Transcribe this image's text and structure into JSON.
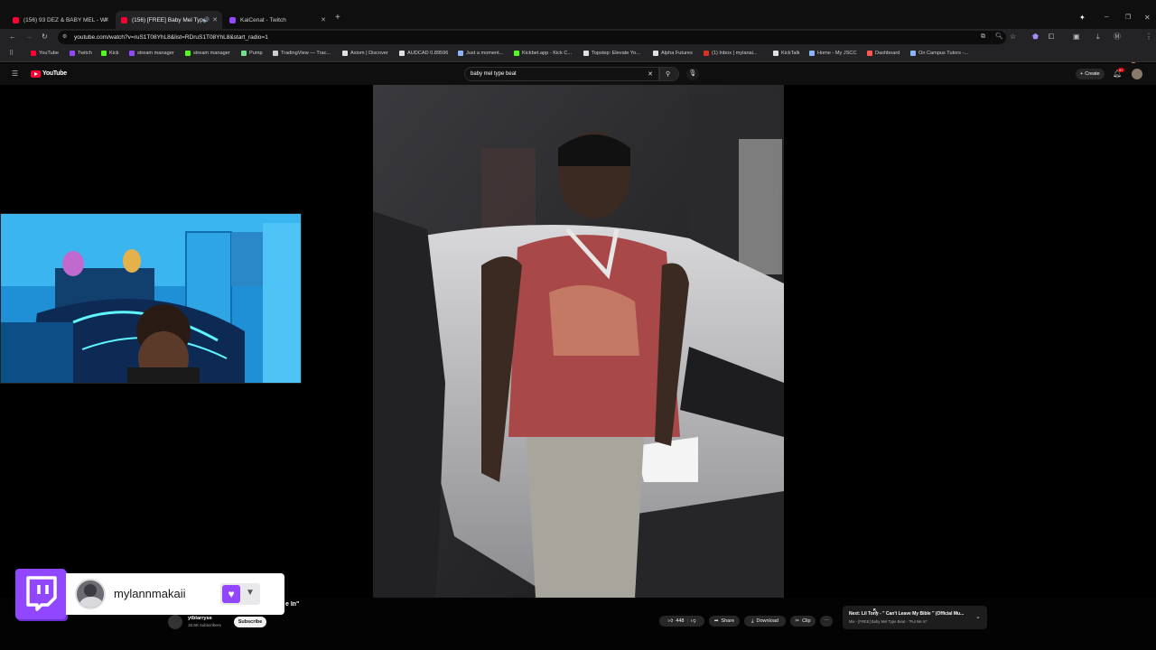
{
  "browser": {
    "tabs": [
      {
        "title": "(156) 93 DEZ & BABY MEL - Wi",
        "color": "#ff0033",
        "active": false
      },
      {
        "title": "(156) [FREE] Baby Mel Type",
        "color": "#ff0033",
        "active": true
      },
      {
        "title": "KaiCenat - Twitch",
        "color": "#9146ff",
        "active": false
      }
    ],
    "new_tab": "+",
    "url": "youtube.com/watch?v=ruS1T08YhL8&list=RDruS1T08YhL8&start_radio=1",
    "bookmarks": [
      {
        "label": "YouTube",
        "color": "#ff0033"
      },
      {
        "label": "Twitch",
        "color": "#9146ff"
      },
      {
        "label": "Kick",
        "color": "#53fc18"
      },
      {
        "label": "stream manager",
        "color": "#9146ff"
      },
      {
        "label": "stream manager",
        "color": "#53fc18"
      },
      {
        "label": "Pump",
        "color": "#6fe38a"
      },
      {
        "label": "TradingView — Trac...",
        "color": "#cccccc"
      },
      {
        "label": "Axiom | Discover",
        "color": "#e0e0e0"
      },
      {
        "label": "AUDCAD 0.89596",
        "color": "#e0e0e0"
      },
      {
        "label": "Just a moment...",
        "color": "#8ab4f8"
      },
      {
        "label": "Kickbet.app - Kick C...",
        "color": "#53fc18"
      },
      {
        "label": "Topstep: Elevate Yo...",
        "color": "#e0e0e0"
      },
      {
        "label": "Alpha Futures",
        "color": "#e0e0e0"
      },
      {
        "label": "(1) Inbox | mylanai...",
        "color": "#d93025"
      },
      {
        "label": "KickTalk",
        "color": "#e0e0e0"
      },
      {
        "label": "Home - My JSCC",
        "color": "#8ab4f8"
      },
      {
        "label": "Dashboard",
        "color": "#ff5555"
      },
      {
        "label": "On Campus Tutors -...",
        "color": "#8ab4f8"
      }
    ]
  },
  "youtube": {
    "logo_text": "YouTube",
    "search_value": "baby mel type beat",
    "create_label": "Create",
    "notification_count": "9+",
    "channel_name": "ytblarryse",
    "subscribers": "16.6K subscribers",
    "subscribe_label": "Subscribe",
    "title_fragment": "e In\"",
    "likes": "448",
    "share_label": "Share",
    "download_label": "Download",
    "clip_label": "Clip",
    "next_title": "Next: Lil Tony - \" Can't Leave My Bible \" (Official Mu...",
    "next_subtitle": "Mix - [FREE] Baby Mel Type Beat - \"Put Me In\""
  },
  "twitch_overlay": {
    "username": "mylannmakaii"
  },
  "colors": {
    "twitch_purple": "#9146ff",
    "youtube_red": "#ff0033"
  }
}
